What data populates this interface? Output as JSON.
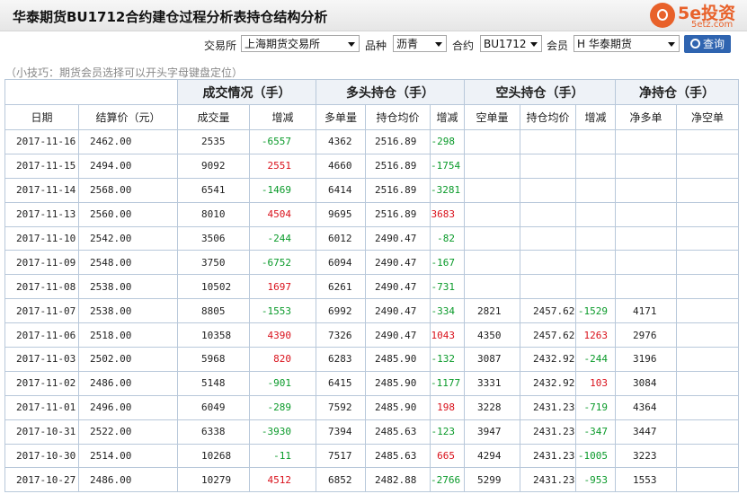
{
  "header": {
    "title": "华泰期货BU1712合约建仓过程分析表持仓结构分析",
    "logo_name": "5e投资",
    "logo_url": "5etz.com"
  },
  "filters": {
    "exchange_label": "交易所",
    "exchange_value": "上海期货交易所",
    "variety_label": "品种",
    "variety_value": "沥青",
    "contract_label": "合约",
    "contract_value": "BU1712",
    "member_label": "会员",
    "member_value": "H 华泰期货",
    "query_label": "查询"
  },
  "tip": "（小技巧：期货会员选择可以开头字母键盘定位）",
  "table": {
    "group_headers": [
      "成交情况（手）",
      "多头持仓（手）",
      "空头持仓（手）",
      "净持仓（手）"
    ],
    "columns": [
      "日期",
      "结算价（元）",
      "成交量",
      "增减",
      "多单量",
      "持仓均价",
      "增减",
      "空单量",
      "持仓均价",
      "增减",
      "净多单",
      "净空单"
    ],
    "rows": [
      [
        "2017-11-16",
        "2462.00",
        "2535",
        "-6557",
        "4362",
        "2516.89",
        "-298",
        "",
        "",
        "",
        "",
        ""
      ],
      [
        "2017-11-15",
        "2494.00",
        "9092",
        "2551",
        "4660",
        "2516.89",
        "-1754",
        "",
        "",
        "",
        "",
        ""
      ],
      [
        "2017-11-14",
        "2568.00",
        "6541",
        "-1469",
        "6414",
        "2516.89",
        "-3281",
        "",
        "",
        "",
        "",
        ""
      ],
      [
        "2017-11-13",
        "2560.00",
        "8010",
        "4504",
        "9695",
        "2516.89",
        "3683",
        "",
        "",
        "",
        "",
        ""
      ],
      [
        "2017-11-10",
        "2542.00",
        "3506",
        "-244",
        "6012",
        "2490.47",
        "-82",
        "",
        "",
        "",
        "",
        ""
      ],
      [
        "2017-11-09",
        "2548.00",
        "3750",
        "-6752",
        "6094",
        "2490.47",
        "-167",
        "",
        "",
        "",
        "",
        ""
      ],
      [
        "2017-11-08",
        "2538.00",
        "10502",
        "1697",
        "6261",
        "2490.47",
        "-731",
        "",
        "",
        "",
        "",
        ""
      ],
      [
        "2017-11-07",
        "2538.00",
        "8805",
        "-1553",
        "6992",
        "2490.47",
        "-334",
        "2821",
        "2457.62",
        "-1529",
        "4171",
        ""
      ],
      [
        "2017-11-06",
        "2518.00",
        "10358",
        "4390",
        "7326",
        "2490.47",
        "1043",
        "4350",
        "2457.62",
        "1263",
        "2976",
        ""
      ],
      [
        "2017-11-03",
        "2502.00",
        "5968",
        "820",
        "6283",
        "2485.90",
        "-132",
        "3087",
        "2432.92",
        "-244",
        "3196",
        ""
      ],
      [
        "2017-11-02",
        "2486.00",
        "5148",
        "-901",
        "6415",
        "2485.90",
        "-1177",
        "3331",
        "2432.92",
        "103",
        "3084",
        ""
      ],
      [
        "2017-11-01",
        "2496.00",
        "6049",
        "-289",
        "7592",
        "2485.90",
        "198",
        "3228",
        "2431.23",
        "-719",
        "4364",
        ""
      ],
      [
        "2017-10-31",
        "2522.00",
        "6338",
        "-3930",
        "7394",
        "2485.63",
        "-123",
        "3947",
        "2431.23",
        "-347",
        "3447",
        ""
      ],
      [
        "2017-10-30",
        "2514.00",
        "10268",
        "-11",
        "7517",
        "2485.63",
        "665",
        "4294",
        "2431.23",
        "-1005",
        "3223",
        ""
      ],
      [
        "2017-10-27",
        "2486.00",
        "10279",
        "4512",
        "6852",
        "2482.88",
        "-2766",
        "5299",
        "2431.23",
        "-953",
        "1553",
        ""
      ]
    ]
  },
  "colors": {
    "increase": "#d9111b",
    "decrease": "#0a9a2a",
    "button": "#2f64b0",
    "brand": "#e8612a"
  }
}
